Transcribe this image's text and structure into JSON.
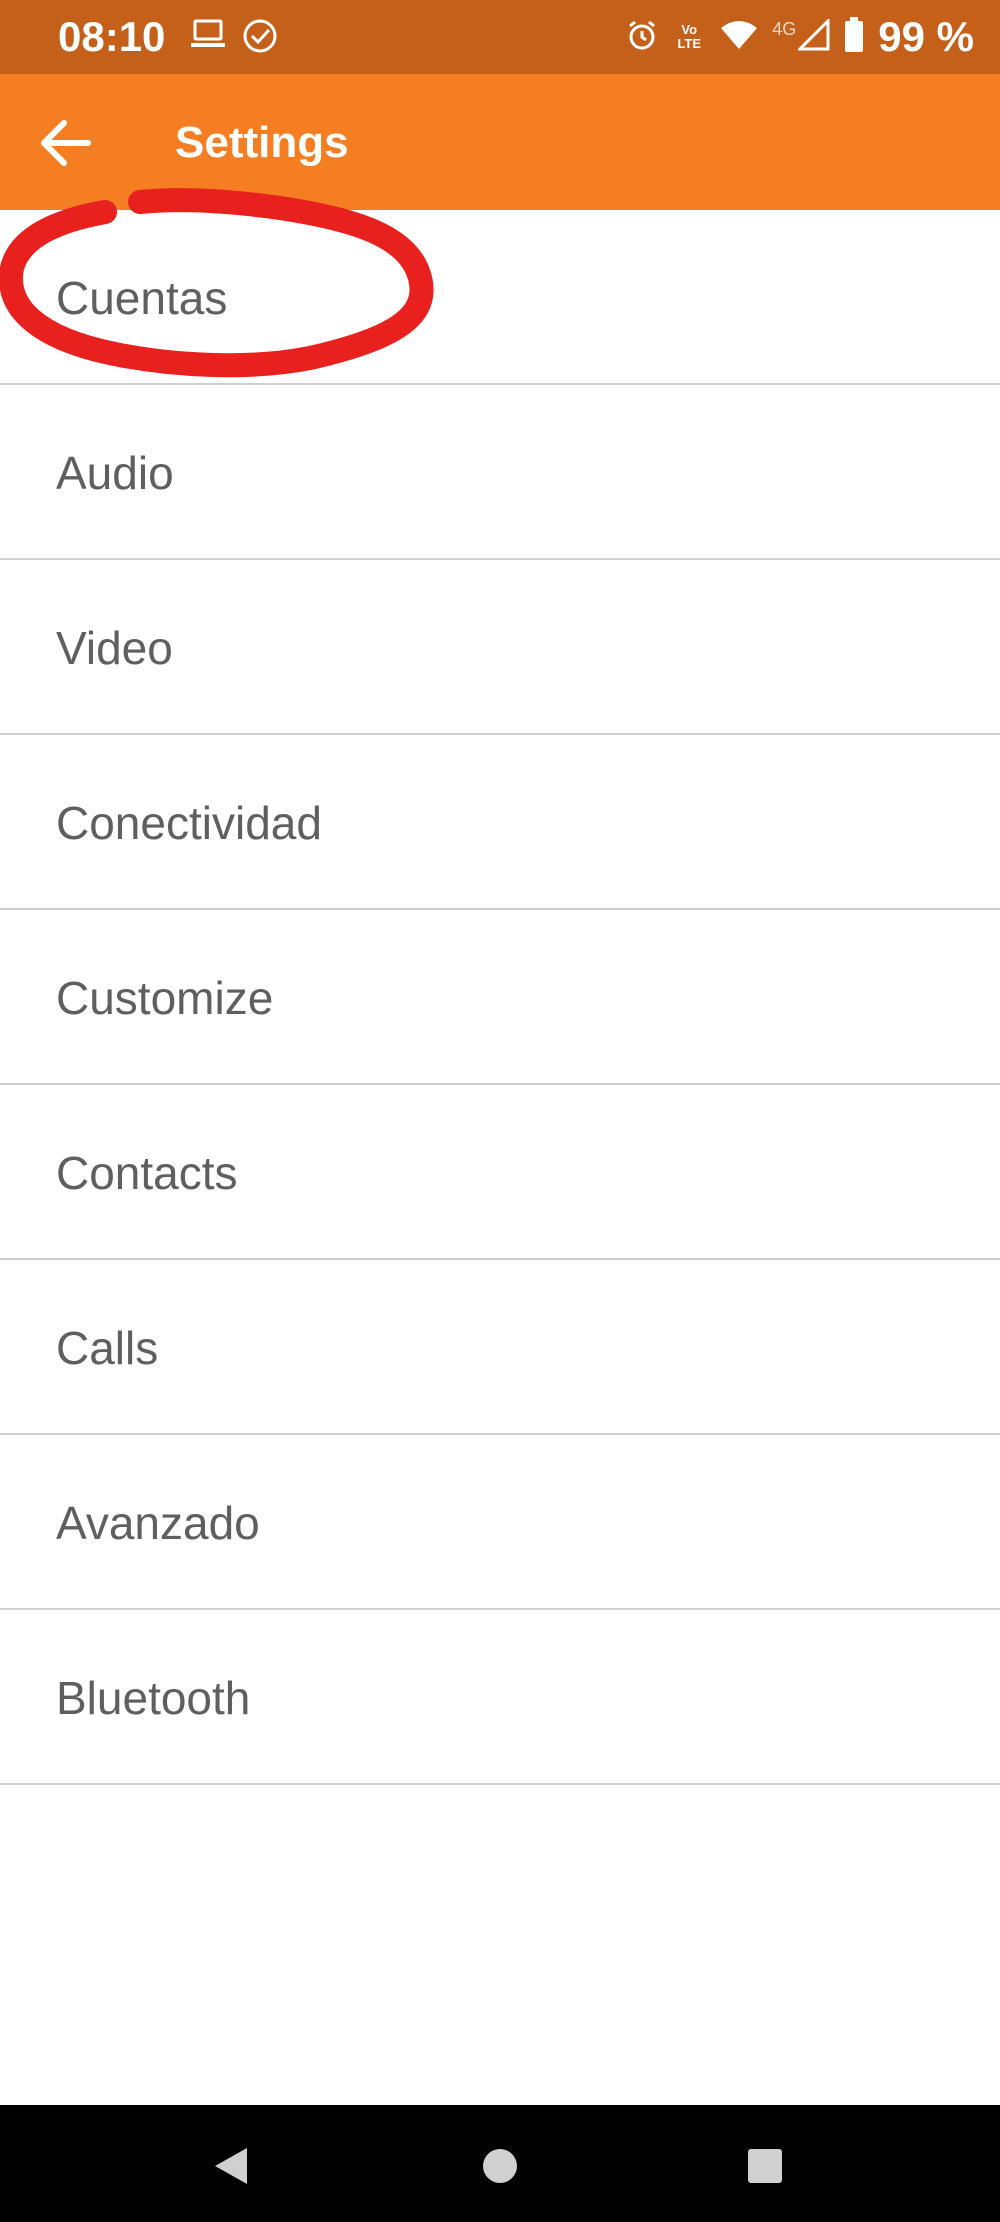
{
  "status_bar": {
    "time": "08:10",
    "volte_top": "Vo",
    "volte_bottom": "LTE",
    "network": "4G",
    "battery": "99 %",
    "icons": [
      "laptop-icon",
      "check-circle-icon",
      "alarm-icon",
      "volte-icon",
      "wifi-icon",
      "signal-icon",
      "battery-icon"
    ]
  },
  "app_bar": {
    "title": "Settings",
    "back_icon": "arrow-back-icon",
    "background_color": "#f67e22"
  },
  "settings_items": [
    {
      "label": "Cuentas"
    },
    {
      "label": "Audio"
    },
    {
      "label": "Video"
    },
    {
      "label": "Conectividad"
    },
    {
      "label": "Customize"
    },
    {
      "label": "Contacts"
    },
    {
      "label": "Calls"
    },
    {
      "label": "Avanzado"
    },
    {
      "label": "Bluetooth"
    }
  ],
  "annotation": {
    "type": "hand-drawn circle",
    "color": "#e8201e"
  },
  "nav_bar": {
    "icons": [
      "nav-back-icon",
      "nav-home-icon",
      "nav-recents-icon"
    ]
  }
}
